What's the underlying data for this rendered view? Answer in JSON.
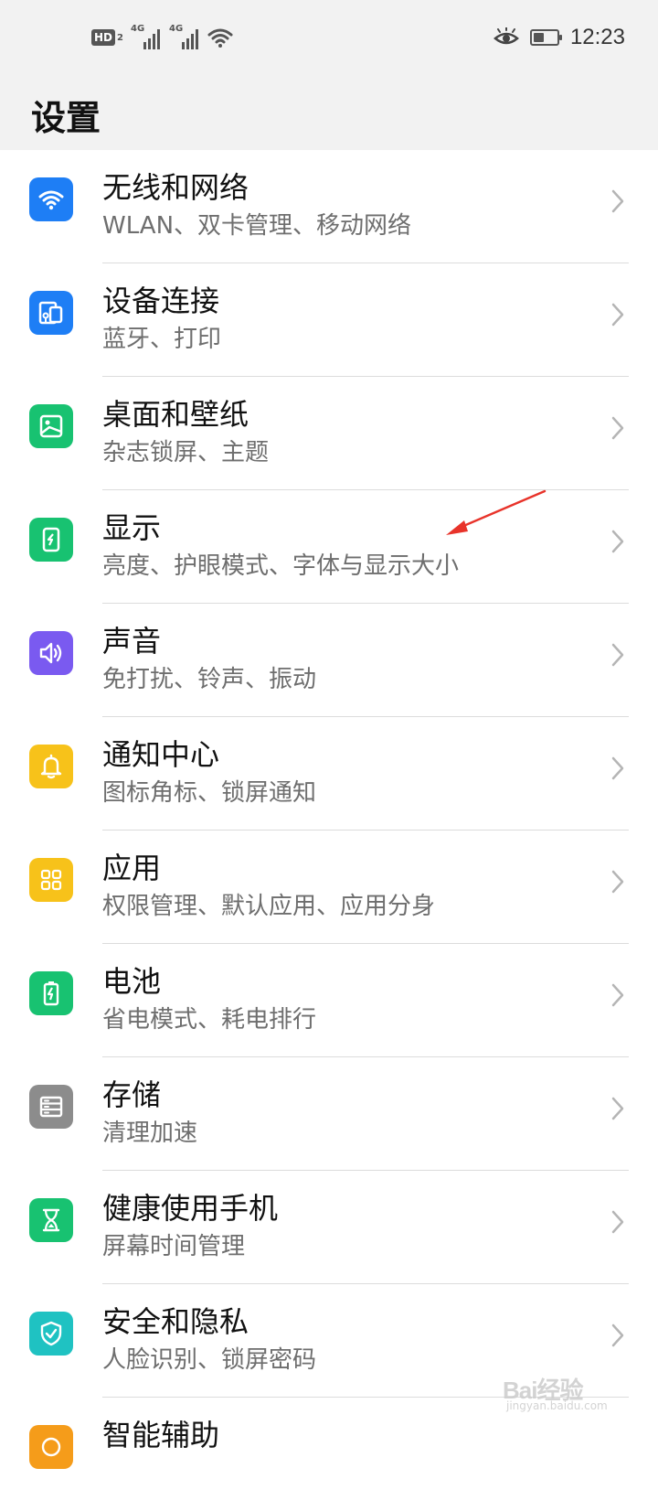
{
  "status_bar": {
    "hd_label": "HD",
    "hd_sub": "2",
    "sim1_label": "4G",
    "sim2_label": "4G",
    "time": "12:23",
    "battery_level": 0.45,
    "icons": [
      "hd-voice-icon",
      "signal-icon",
      "signal-icon",
      "wifi-icon",
      "eye-comfort-icon",
      "battery-icon"
    ]
  },
  "header": {
    "title": "设置"
  },
  "settings": [
    {
      "title": "无线和网络",
      "subtitle": "WLAN、双卡管理、移动网络",
      "icon": "wifi-icon",
      "color": "#1e7ef5"
    },
    {
      "title": "设备连接",
      "subtitle": "蓝牙、打印",
      "icon": "device-connect-icon",
      "color": "#1e7ef5"
    },
    {
      "title": "桌面和壁纸",
      "subtitle": "杂志锁屏、主题",
      "icon": "wallpaper-icon",
      "color": "#18c271"
    },
    {
      "title": "显示",
      "subtitle": "亮度、护眼模式、字体与显示大小",
      "icon": "display-icon",
      "color": "#18c271"
    },
    {
      "title": "声音",
      "subtitle": "免打扰、铃声、振动",
      "icon": "sound-icon",
      "color": "#7a5af0"
    },
    {
      "title": "通知中心",
      "subtitle": "图标角标、锁屏通知",
      "icon": "bell-icon",
      "color": "#f7c21a"
    },
    {
      "title": "应用",
      "subtitle": "权限管理、默认应用、应用分身",
      "icon": "apps-icon",
      "color": "#f7c21a"
    },
    {
      "title": "电池",
      "subtitle": "省电模式、耗电排行",
      "icon": "battery-icon",
      "color": "#18c271"
    },
    {
      "title": "存储",
      "subtitle": "清理加速",
      "icon": "storage-icon",
      "color": "#8c8c8c"
    },
    {
      "title": "健康使用手机",
      "subtitle": "屏幕时间管理",
      "icon": "hourglass-icon",
      "color": "#18c271"
    },
    {
      "title": "安全和隐私",
      "subtitle": "人脸识别、锁屏密码",
      "icon": "shield-icon",
      "color": "#1fc2c2"
    },
    {
      "title": "智能辅助",
      "subtitle": "",
      "icon": "assist-icon",
      "color": "#f59c1a"
    }
  ],
  "annotation": {
    "color": "#e8332a"
  },
  "watermark": {
    "brand": "Bai经验",
    "url": "jingyan.baidu.com"
  }
}
